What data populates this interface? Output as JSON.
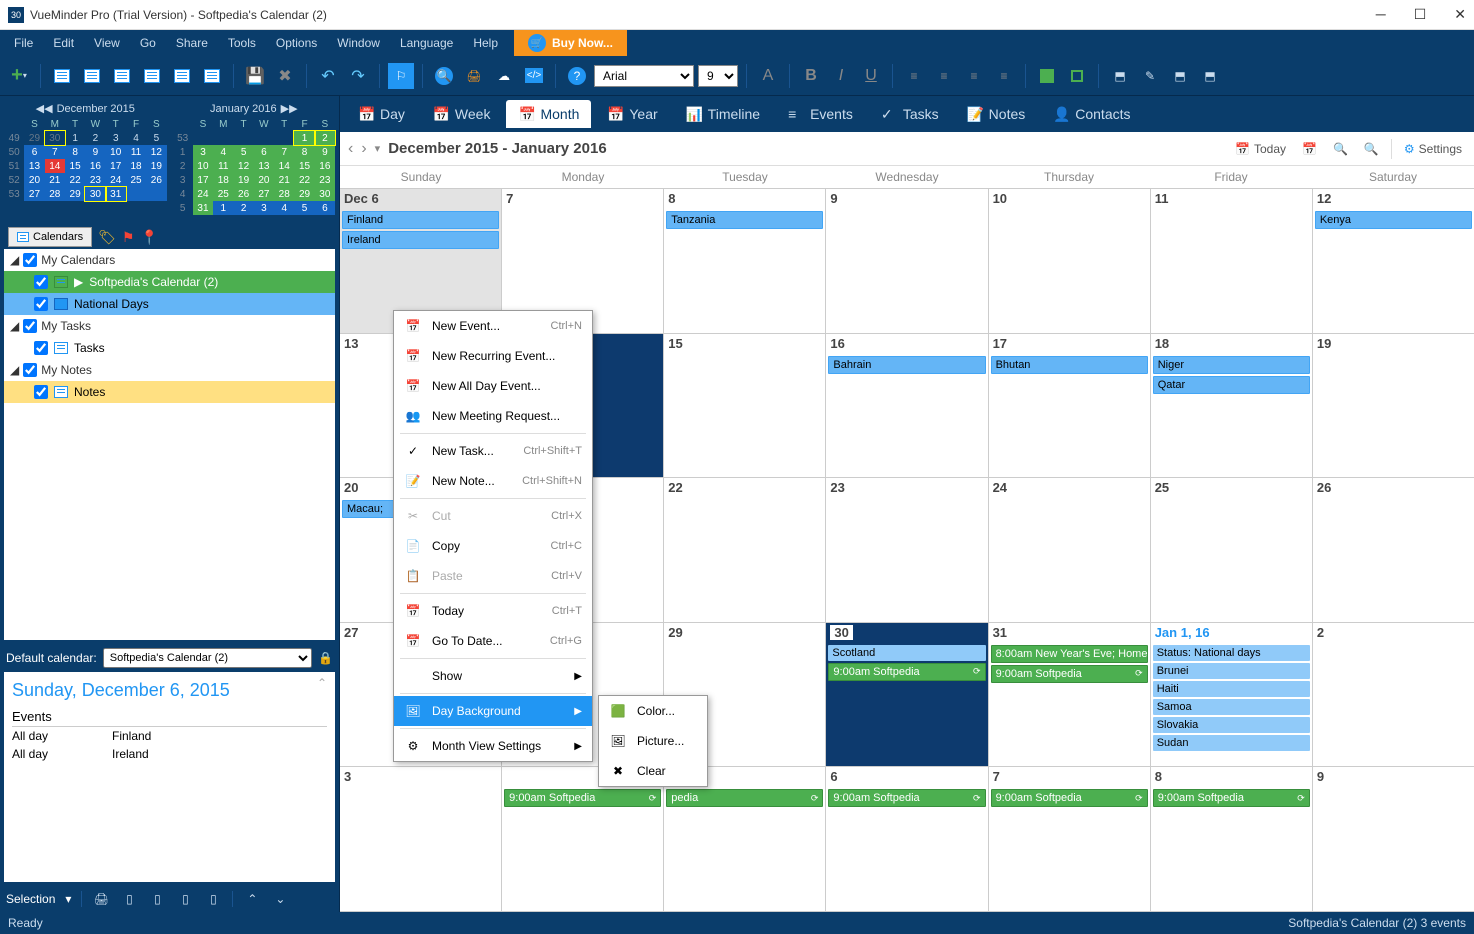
{
  "window": {
    "title": "VueMinder Pro (Trial Version) - Softpedia's Calendar (2)",
    "app_icon": "30"
  },
  "menubar": {
    "items": [
      "File",
      "Edit",
      "View",
      "Go",
      "Share",
      "Tools",
      "Options",
      "Window",
      "Language",
      "Help"
    ],
    "buy_now": "Buy Now..."
  },
  "toolbar": {
    "font_name": "Arial",
    "font_size": "9"
  },
  "mini_cal_1": {
    "title": "December 2015",
    "dow": [
      "S",
      "M",
      "T",
      "W",
      "T",
      "F",
      "S"
    ],
    "weeks": [
      {
        "wk": "49",
        "d": [
          "29",
          "30",
          "1",
          "2",
          "3",
          "4",
          "5"
        ]
      },
      {
        "wk": "50",
        "d": [
          "6",
          "7",
          "8",
          "9",
          "10",
          "11",
          "12"
        ]
      },
      {
        "wk": "51",
        "d": [
          "13",
          "14",
          "15",
          "16",
          "17",
          "18",
          "19"
        ]
      },
      {
        "wk": "52",
        "d": [
          "20",
          "21",
          "22",
          "23",
          "24",
          "25",
          "26"
        ]
      },
      {
        "wk": "53",
        "d": [
          "27",
          "28",
          "29",
          "30",
          "31",
          "",
          ""
        ]
      }
    ]
  },
  "mini_cal_2": {
    "title": "January 2016",
    "dow": [
      "S",
      "M",
      "T",
      "W",
      "T",
      "F",
      "S"
    ],
    "weeks": [
      {
        "wk": "53",
        "d": [
          "",
          "",
          "",
          "",
          "",
          "1",
          "2"
        ]
      },
      {
        "wk": "1",
        "d": [
          "3",
          "4",
          "5",
          "6",
          "7",
          "8",
          "9"
        ]
      },
      {
        "wk": "2",
        "d": [
          "10",
          "11",
          "12",
          "13",
          "14",
          "15",
          "16"
        ]
      },
      {
        "wk": "3",
        "d": [
          "17",
          "18",
          "19",
          "20",
          "21",
          "22",
          "23"
        ]
      },
      {
        "wk": "4",
        "d": [
          "24",
          "25",
          "26",
          "27",
          "28",
          "29",
          "30"
        ]
      },
      {
        "wk": "5",
        "d": [
          "31",
          "1",
          "2",
          "3",
          "4",
          "5",
          "6"
        ]
      }
    ]
  },
  "cal_tree": {
    "tab": "Calendars",
    "groups": {
      "cal": {
        "label": "My Calendars",
        "items": [
          {
            "label": "Softpedia's Calendar (2)",
            "cls": "sel-green"
          },
          {
            "label": "National Days",
            "cls": "sel-blue"
          }
        ]
      },
      "tasks": {
        "label": "My Tasks",
        "items": [
          {
            "label": "Tasks",
            "cls": ""
          }
        ]
      },
      "notes": {
        "label": "My Notes",
        "items": [
          {
            "label": "Notes",
            "cls": "sel-yellow"
          }
        ]
      }
    }
  },
  "default_cal": {
    "label": "Default calendar:",
    "value": "Softpedia's Calendar (2)"
  },
  "detail": {
    "date": "Sunday, December 6, 2015",
    "events_h": "Events",
    "rows": [
      {
        "t": "All day",
        "e": "Finland"
      },
      {
        "t": "All day",
        "e": "Ireland"
      }
    ]
  },
  "sel_footer": {
    "label": "Selection"
  },
  "view_tabs": {
    "items": [
      "Day",
      "Week",
      "Month",
      "Year",
      "Timeline",
      "Events",
      "Tasks",
      "Notes",
      "Contacts"
    ],
    "active": "Month"
  },
  "cal_header": {
    "range": "December 2015 - January 2016",
    "today": "Today",
    "settings": "Settings"
  },
  "month": {
    "dow": [
      "Sunday",
      "Monday",
      "Tuesday",
      "Wednesday",
      "Thursday",
      "Friday",
      "Saturday"
    ],
    "rows": [
      {
        "cells": [
          {
            "num": "Dec 6",
            "sel": true,
            "ev": [
              {
                "t": "Finland",
                "c": "ev-blue"
              },
              {
                "t": "Ireland",
                "c": "ev-blue"
              }
            ]
          },
          {
            "num": "7",
            "ev": []
          },
          {
            "num": "8",
            "ev": [
              {
                "t": "Tanzania",
                "c": "ev-blue"
              }
            ]
          },
          {
            "num": "9",
            "ev": []
          },
          {
            "num": "10",
            "ev": []
          },
          {
            "num": "11",
            "ev": []
          },
          {
            "num": "12",
            "ev": [
              {
                "t": "Kenya",
                "c": "ev-blue"
              }
            ]
          }
        ]
      },
      {
        "cells": [
          {
            "num": "13",
            "ev": []
          },
          {
            "num": "",
            "bg": "dark",
            "ev": []
          },
          {
            "num": "15",
            "ev": []
          },
          {
            "num": "16",
            "ev": [
              {
                "t": "Bahrain",
                "c": "ev-blue"
              }
            ]
          },
          {
            "num": "17",
            "ev": [
              {
                "t": "Bhutan",
                "c": "ev-blue"
              }
            ]
          },
          {
            "num": "18",
            "ev": [
              {
                "t": "Niger",
                "c": "ev-blue"
              },
              {
                "t": "Qatar",
                "c": "ev-blue"
              }
            ]
          },
          {
            "num": "19",
            "ev": []
          }
        ]
      },
      {
        "cells": [
          {
            "num": "20",
            "ev": [
              {
                "t": "Macau;",
                "c": "ev-blue"
              }
            ]
          },
          {
            "num": "",
            "ev": []
          },
          {
            "num": "22",
            "ev": []
          },
          {
            "num": "23",
            "ev": []
          },
          {
            "num": "24",
            "ev": []
          },
          {
            "num": "25",
            "ev": []
          },
          {
            "num": "26",
            "ev": []
          }
        ]
      },
      {
        "cells": [
          {
            "num": "27",
            "ev": []
          },
          {
            "num": "",
            "ev": []
          },
          {
            "num": "29",
            "ev": []
          },
          {
            "num": "30",
            "bg": "dark",
            "ev": [
              {
                "t": "Scotland",
                "c": "ev-lightblue"
              },
              {
                "t": "9:00am Softpedia",
                "c": "ev-green"
              }
            ]
          },
          {
            "num": "31",
            "ev": [
              {
                "t": "8:00am New Year's Eve; Home",
                "c": "ev-green"
              },
              {
                "t": "9:00am Softpedia",
                "c": "ev-green"
              }
            ]
          },
          {
            "num": "Jan 1, 16",
            "blue": true,
            "ev": [
              {
                "t": "Status: National days",
                "c": "ev-lightblue"
              },
              {
                "t": "Brunei",
                "c": "ev-lightblue"
              },
              {
                "t": "Haiti",
                "c": "ev-lightblue"
              },
              {
                "t": "Samoa",
                "c": "ev-lightblue"
              },
              {
                "t": "Slovakia",
                "c": "ev-lightblue"
              },
              {
                "t": "Sudan",
                "c": "ev-lightblue"
              }
            ]
          },
          {
            "num": "2",
            "ev": []
          }
        ]
      },
      {
        "cells": [
          {
            "num": "3",
            "ev": []
          },
          {
            "num": "",
            "ev": [
              {
                "t": "9:00am Softpedia",
                "c": "ev-green"
              }
            ]
          },
          {
            "num": "",
            "ev": [
              {
                "t": "pedia",
                "c": "ev-green"
              }
            ]
          },
          {
            "num": "6",
            "ev": [
              {
                "t": "9:00am Softpedia",
                "c": "ev-green"
              }
            ]
          },
          {
            "num": "7",
            "ev": [
              {
                "t": "9:00am Softpedia",
                "c": "ev-green"
              }
            ]
          },
          {
            "num": "8",
            "ev": [
              {
                "t": "9:00am Softpedia",
                "c": "ev-green"
              }
            ]
          },
          {
            "num": "9",
            "ev": []
          }
        ]
      }
    ]
  },
  "ctx_menu": {
    "items": [
      {
        "label": "New Event...",
        "short": "Ctrl+N",
        "icon": "📅"
      },
      {
        "label": "New Recurring Event...",
        "icon": "📅"
      },
      {
        "label": "New All Day Event...",
        "icon": "📅"
      },
      {
        "label": "New Meeting Request...",
        "icon": "👥"
      },
      {
        "sep": true
      },
      {
        "label": "New Task...",
        "short": "Ctrl+Shift+T",
        "icon": "✓"
      },
      {
        "label": "New Note...",
        "short": "Ctrl+Shift+N",
        "icon": "📝"
      },
      {
        "sep": true
      },
      {
        "label": "Cut",
        "short": "Ctrl+X",
        "icon": "✂",
        "disabled": true
      },
      {
        "label": "Copy",
        "short": "Ctrl+C",
        "icon": "📄"
      },
      {
        "label": "Paste",
        "short": "Ctrl+V",
        "icon": "📋",
        "disabled": true
      },
      {
        "sep": true
      },
      {
        "label": "Today",
        "short": "Ctrl+T",
        "icon": "📅"
      },
      {
        "label": "Go To Date...",
        "short": "Ctrl+G",
        "icon": "📅"
      },
      {
        "sep": true
      },
      {
        "label": "Show",
        "arrow": true
      },
      {
        "sep": true
      },
      {
        "label": "Day Background",
        "arrow": true,
        "hl": true,
        "icon": "🖼"
      },
      {
        "sep": true
      },
      {
        "label": "Month View Settings",
        "arrow": true,
        "icon": "⚙"
      }
    ]
  },
  "ctx_sub": {
    "items": [
      {
        "label": "Color...",
        "icon": "🟩"
      },
      {
        "label": "Picture...",
        "icon": "🖼"
      },
      {
        "label": "Clear",
        "icon": "✖"
      }
    ]
  },
  "statusbar": {
    "left": "Ready",
    "right": "Softpedia's Calendar (2)    3 events"
  }
}
